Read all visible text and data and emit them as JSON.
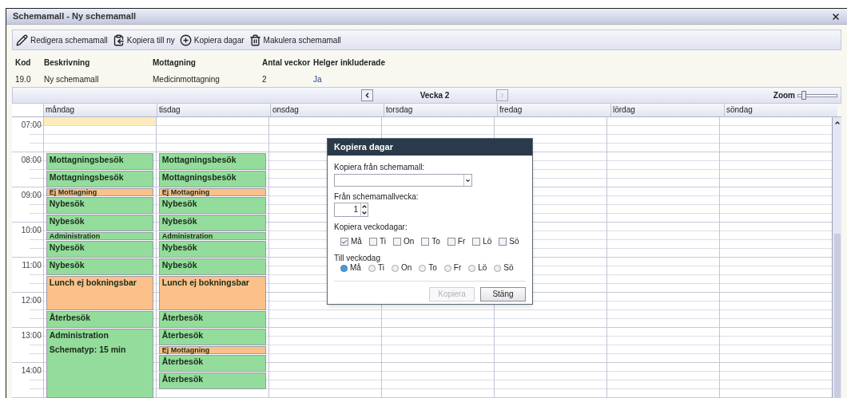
{
  "window": {
    "title": "Schemamall - Ny schemamall"
  },
  "toolbar": [
    {
      "label": "Redigera schemamall",
      "kind": "edit"
    },
    {
      "label": "Kopiera till ny",
      "kind": "copy"
    },
    {
      "label": "Kopiera dagar",
      "kind": "add"
    },
    {
      "label": "Makulera schemamall",
      "kind": "delete"
    }
  ],
  "details": [
    {
      "heading": "Kod",
      "value": "19.0"
    },
    {
      "heading": "Beskrivning",
      "value": "Ny schemamall"
    },
    {
      "heading": "Mottagning",
      "value": "Medicinmottagning"
    },
    {
      "heading": "Antal veckor",
      "value": "2"
    },
    {
      "heading": "Helger inkluderade",
      "value": "Ja"
    }
  ],
  "week_nav": {
    "label": "Vecka 2",
    "prev_disabled": false,
    "next_disabled": true
  },
  "zoom": {
    "label": "Zoom",
    "level": 0.15
  },
  "calendar": {
    "hours": [
      "07:00",
      "08:00",
      "09:00",
      "10:00",
      "11:00",
      "12:00",
      "13:00",
      "14:00"
    ],
    "days": [
      {
        "name": "måndag",
        "selected": true,
        "events": [
          {
            "title": "Mottagningsbesök",
            "kind": "half",
            "color": "#93dc9b"
          },
          {
            "title": "Mottagningsbesök",
            "kind": "half",
            "color": "#93dc9b"
          },
          {
            "title": "Ej Mottagning",
            "kind": "quarter",
            "color": "#fcc18a"
          },
          {
            "title": "Nybesök",
            "kind": "half",
            "color": "#93dc9b"
          },
          {
            "title": "Nybesök",
            "kind": "half",
            "color": "#93dc9b"
          },
          {
            "title": "Administration",
            "kind": "quarter",
            "color": "#93dc9b"
          },
          {
            "title": "Nybesök",
            "kind": "half",
            "color": "#93dc9b"
          },
          {
            "title": "Nybesök",
            "kind": "half",
            "color": "#93dc9b"
          },
          {
            "title": "Lunch ej bokningsbar",
            "kind": "hour",
            "color": "#fcc18a"
          },
          {
            "title": "Återbesök",
            "kind": "half",
            "color": "#93dc9b"
          },
          {
            "title": "Administration",
            "subtitle": "Schematyp: 15 min",
            "kind": "long",
            "color": "#93dc9b"
          }
        ]
      },
      {
        "name": "tisdag",
        "selected": false,
        "events": [
          {
            "title": "Mottagningsbesök",
            "kind": "half",
            "color": "#93dc9b"
          },
          {
            "title": "Mottagningsbesök",
            "kind": "half",
            "color": "#93dc9b"
          },
          {
            "title": "Ej Mottagning",
            "kind": "quarter",
            "color": "#fcc18a"
          },
          {
            "title": "Nybesök",
            "kind": "half",
            "color": "#93dc9b"
          },
          {
            "title": "Nybesök",
            "kind": "half",
            "color": "#93dc9b"
          },
          {
            "title": "Administration",
            "kind": "quarter",
            "color": "#93dc9b"
          },
          {
            "title": "Nybesök",
            "kind": "half",
            "color": "#93dc9b"
          },
          {
            "title": "Nybesök",
            "kind": "half",
            "color": "#93dc9b"
          },
          {
            "title": "Lunch ej bokningsbar",
            "kind": "hour",
            "color": "#fcc18a"
          },
          {
            "title": "Återbesök",
            "kind": "half",
            "color": "#93dc9b"
          },
          {
            "title": "Återbesök",
            "kind": "half",
            "color": "#93dc9b"
          },
          {
            "title": "Ej Mottagning",
            "kind": "quarter",
            "color": "#fcc18a"
          },
          {
            "title": "Återbesök",
            "kind": "half",
            "color": "#93dc9b"
          },
          {
            "title": "Återbesök",
            "kind": "half",
            "color": "#93dc9b"
          }
        ]
      },
      {
        "name": "onsdag",
        "selected": false
      },
      {
        "name": "torsdag",
        "selected": false
      },
      {
        "name": "fredag",
        "selected": false
      },
      {
        "name": "lördag",
        "selected": false
      },
      {
        "name": "söndag",
        "selected": false
      }
    ]
  },
  "dialog": {
    "title": "Kopiera dagar",
    "template_label": "Kopiera från schemamall:",
    "week_label": "Från schemamallvecka:",
    "week_value": "1",
    "copy_days_label": "Kopiera veckodagar:",
    "copy_days": [
      {
        "label": "Må",
        "checked": true
      },
      {
        "label": "Ti",
        "checked": false
      },
      {
        "label": "On",
        "checked": false
      },
      {
        "label": "To",
        "checked": false
      },
      {
        "label": "Fr",
        "checked": false
      },
      {
        "label": "Lö",
        "checked": false
      },
      {
        "label": "Sö",
        "checked": false
      }
    ],
    "to_day_label": "Till veckodag",
    "to_days": [
      {
        "label": "Må",
        "selected": true
      },
      {
        "label": "Ti",
        "selected": false
      },
      {
        "label": "On",
        "selected": false
      },
      {
        "label": "To",
        "selected": false
      },
      {
        "label": "Fr",
        "selected": false
      },
      {
        "label": "Lö",
        "selected": false
      },
      {
        "label": "Sö",
        "selected": false
      }
    ],
    "buttons": [
      {
        "label": "Kopiera",
        "disabled": true
      },
      {
        "label": "Stäng",
        "disabled": false
      }
    ]
  }
}
